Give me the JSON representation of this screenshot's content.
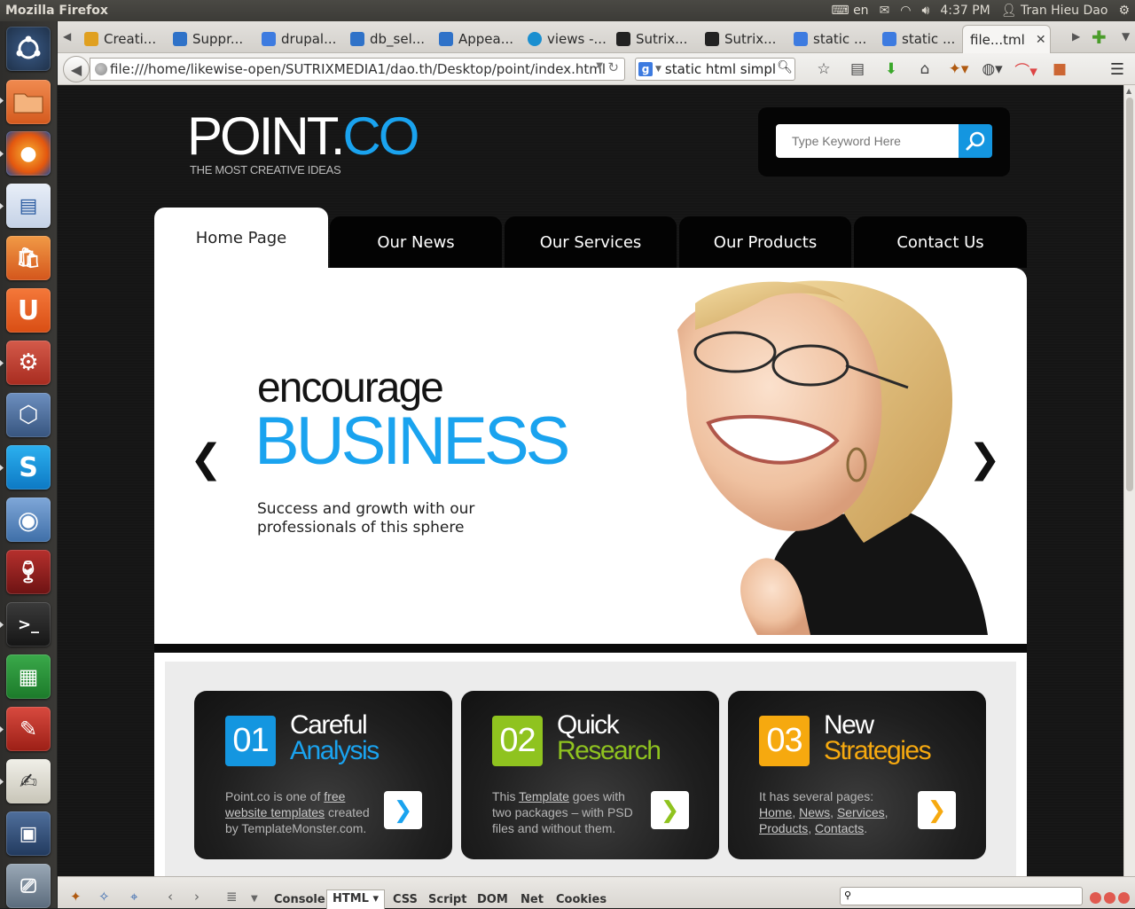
{
  "os": {
    "window_title": "Mozilla Firefox",
    "keyboard": "en",
    "clock": "4:37 PM",
    "user": "Tran Hieu Dao"
  },
  "launcher": {
    "items": [
      "ubuntu-dash",
      "files",
      "firefox",
      "libreoffice-writer",
      "ubuntu-software-center",
      "ubuntu-one",
      "system-settings",
      "workspace",
      "skype",
      "chromium",
      "wine",
      "terminal",
      "libreoffice-calc",
      "pdf-viewer",
      "text-editor",
      "workspace-switcher",
      "trash"
    ]
  },
  "browser": {
    "tabs": [
      {
        "label": "Creati...",
        "color": "#e0a020"
      },
      {
        "label": "Suppr...",
        "color": "#2f72c8"
      },
      {
        "label": "drupal...",
        "color": "#3d7be0"
      },
      {
        "label": "db_sel...",
        "color": "#2f72c8"
      },
      {
        "label": "Appea...",
        "color": "#2f72c8"
      },
      {
        "label": "views -...",
        "color": "#1a8fd0"
      },
      {
        "label": "Sutrix...",
        "color": "#222222"
      },
      {
        "label": "Sutrix...",
        "color": "#222222"
      },
      {
        "label": "static ...",
        "color": "#3d7be0"
      },
      {
        "label": "static ...",
        "color": "#3d7be0"
      },
      {
        "label": "file...tml",
        "color": "",
        "active": true
      }
    ],
    "url": "file:///home/likewise-open/SUTRIXMEDIA1/dao.th/Desktop/point/index.html",
    "search_value": "static html simple"
  },
  "site": {
    "logo_main": "POINT.",
    "logo_accent": "CO",
    "tagline": "THE MOST CREATIVE IDEAS",
    "search_placeholder": "Type Keyword Here",
    "nav": [
      "Home Page",
      "Our News",
      "Our Services",
      "Our Products",
      "Contact Us"
    ],
    "active_nav": "Home Page",
    "slide": {
      "line1": "encourage",
      "line2": "BUSINESS",
      "desc": "Success and growth with our professionals of this sphere"
    },
    "features": [
      {
        "num": "01",
        "t1": "Careful",
        "t2": "Analysis",
        "accent": "#1aa3ef",
        "text_pre": "Point.co is one of ",
        "link1": "free website templates",
        "text_post": " created by TemplateMonster.com."
      },
      {
        "num": "02",
        "t1": "Quick",
        "t2": "Research",
        "accent": "#8fc31f",
        "text_pre": "This ",
        "link1": "Template",
        "text_post": " goes with two packages – with PSD files and without them."
      },
      {
        "num": "03",
        "t1": "New",
        "t2": "Strategies",
        "accent": "#f6a90f",
        "text_pre": "It has several pages: ",
        "links": [
          "Home",
          "News",
          "Services",
          "Products",
          "Contacts"
        ],
        "text_post": "."
      }
    ]
  },
  "firebug": {
    "tabs": [
      "Console",
      "HTML",
      "CSS",
      "Script",
      "DOM",
      "Net",
      "Cookies"
    ],
    "active": "HTML"
  }
}
